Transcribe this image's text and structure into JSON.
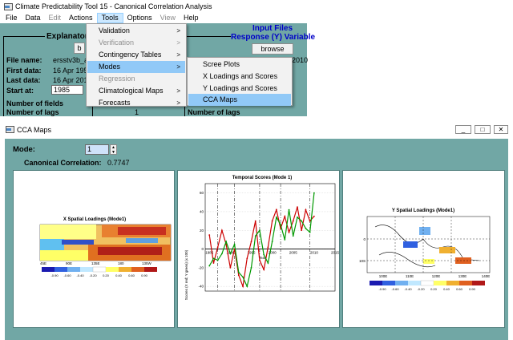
{
  "app": {
    "title": "Climate Predictability Tool 15 - Canonical Correlation Analysis",
    "menus": [
      {
        "label": "File",
        "state": "normal"
      },
      {
        "label": "Data",
        "state": "normal"
      },
      {
        "label": "Edit",
        "state": "disabled"
      },
      {
        "label": "Actions",
        "state": "normal"
      },
      {
        "label": "Tools",
        "state": "active"
      },
      {
        "label": "Options",
        "state": "normal"
      },
      {
        "label": "View",
        "state": "disabled"
      },
      {
        "label": "Help",
        "state": "normal"
      }
    ]
  },
  "explanatory": {
    "heading": "Explanator",
    "browse_label": "b",
    "file_name_label": "File name:",
    "file_name_value": "ersstv3b_a",
    "first_data_label": "First data:",
    "first_data_value": "16 Apr 195",
    "last_data_label": "Last data:",
    "last_data_value": "16 Apr 201",
    "start_at_label": "Start at:",
    "start_at_value": "1985",
    "fields_label": "Number of fields",
    "lags_label": "Number of lags",
    "lags_value": "1"
  },
  "response": {
    "heading_line1": "Input Files",
    "heading_line2": "Response (Y) Variable",
    "browse_label": "browse",
    "partial_value": "2010",
    "lags_label": "Number of lags"
  },
  "tools_menu": [
    {
      "label": "Validation",
      "enabled": true,
      "submenu": true
    },
    {
      "label": "Verification",
      "enabled": false,
      "submenu": true
    },
    {
      "label": "Contingency Tables",
      "enabled": true,
      "submenu": true
    },
    {
      "label": "Modes",
      "enabled": true,
      "submenu": true,
      "highlighted": true
    },
    {
      "label": "Regression",
      "enabled": false,
      "submenu": false
    },
    {
      "label": "Climatological Maps",
      "enabled": true,
      "submenu": true
    },
    {
      "label": "Forecasts",
      "enabled": true,
      "submenu": true
    }
  ],
  "modes_menu": [
    {
      "label": "Scree Plots",
      "highlighted": false
    },
    {
      "label": "X Loadings and Scores",
      "highlighted": false
    },
    {
      "label": "Y Loadings and Scores",
      "highlighted": false
    },
    {
      "label": "CCA Maps",
      "highlighted": true
    }
  ],
  "cca": {
    "title": "CCA Maps",
    "mode_label": "Mode:",
    "mode_value": "1",
    "canonical_label": "Canonical Correlation:",
    "canonical_value": "0.7747",
    "colors": {
      "bg": "#71a7a5",
      "x_series": "#cc0000",
      "y_series": "#009900"
    }
  },
  "x_map": {
    "title": "X Spatial Loadings (Mode1)",
    "lon_ticks": [
      "45E",
      "90E",
      "135E",
      "180",
      "135W"
    ],
    "colorbar": [
      "-0.90",
      "-0.60",
      "-0.40",
      "-0.20",
      "0.20",
      "0.40",
      "0.60",
      "0.90"
    ]
  },
  "y_map": {
    "title": "Y Spatial Loadings (Mode1)",
    "lat_ticks": [
      "0",
      "10S"
    ],
    "lon_ticks": [
      "100E",
      "110E",
      "120E",
      "130E",
      "140E"
    ],
    "colorbar": [
      "-0.90",
      "-0.60",
      "-0.40",
      "-0.20",
      "0.20",
      "0.40",
      "0.60",
      "0.90"
    ]
  },
  "chart_data": {
    "type": "line",
    "title": "Temporal Scores (Mode 1)",
    "xlabel": "Year",
    "ylabel": "Scores (X red; Y green) (x 100)",
    "xlim": [
      1984,
      2015
    ],
    "ylim": [
      -45,
      70
    ],
    "x_ticks": [
      1985,
      1990,
      1995,
      2000,
      2005,
      2010,
      2015
    ],
    "y_ticks": [
      -40,
      -20,
      0,
      20,
      40,
      60
    ],
    "event_lines_x": [
      1987,
      1991,
      1997,
      2002,
      2009
    ],
    "x": [
      1985,
      1986,
      1987,
      1988,
      1989,
      1990,
      1991,
      1992,
      1993,
      1994,
      1995,
      1996,
      1997,
      1998,
      1999,
      2000,
      2001,
      2002,
      2003,
      2004,
      2005,
      2006,
      2007,
      2008,
      2009,
      2010
    ],
    "series": [
      {
        "name": "X",
        "values": [
          15,
          -15,
          2,
          20,
          5,
          -20,
          0,
          -28,
          -40,
          -10,
          8,
          30,
          -12,
          -22,
          2,
          30,
          42,
          22,
          35,
          18,
          30,
          45,
          20,
          42,
          30,
          35
        ]
      },
      {
        "name": "Y",
        "values": [
          -18,
          -10,
          -12,
          -5,
          8,
          -5,
          5,
          -25,
          -30,
          -40,
          -20,
          14,
          20,
          -6,
          -15,
          8,
          34,
          26,
          10,
          42,
          14,
          34,
          30,
          22,
          18,
          60
        ]
      }
    ]
  }
}
